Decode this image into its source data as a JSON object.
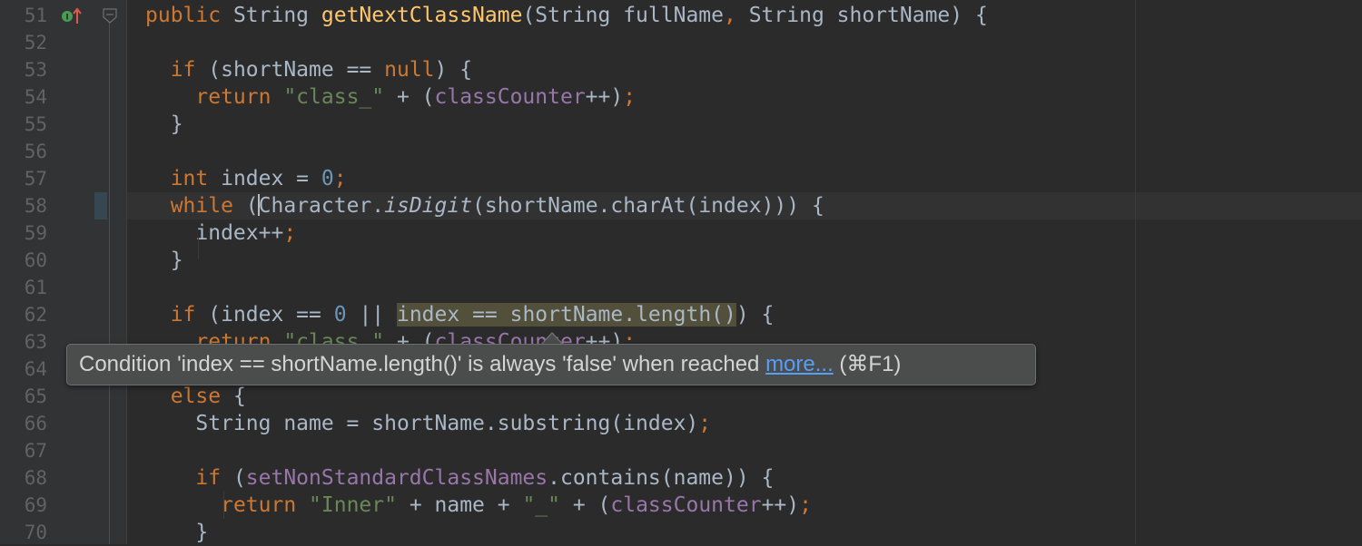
{
  "gutter": {
    "line_numbers": [
      "51",
      "52",
      "53",
      "54",
      "55",
      "56",
      "57",
      "58",
      "59",
      "60",
      "61",
      "62",
      "63",
      "64",
      "65",
      "66",
      "67",
      "68",
      "69",
      "70"
    ],
    "icons": {
      "implements": "implements-method-icon",
      "fold": "fold-marker-icon"
    }
  },
  "editor": {
    "lines": [
      {
        "n": "51",
        "segments": [
          {
            "t": "public ",
            "c": "kw"
          },
          {
            "t": "String ",
            "c": ""
          },
          {
            "t": "getNextClassName",
            "c": "fn"
          },
          {
            "t": "(String fullName",
            "c": ""
          },
          {
            "t": ", ",
            "c": "kw"
          },
          {
            "t": "String shortName) {",
            "c": ""
          }
        ]
      },
      {
        "n": "52",
        "segments": []
      },
      {
        "n": "53",
        "segments": [
          {
            "t": "  "
          },
          {
            "t": "if ",
            "c": "kw"
          },
          {
            "t": "(shortName == ",
            "c": ""
          },
          {
            "t": "null",
            "c": "kw"
          },
          {
            "t": ") {",
            "c": ""
          }
        ]
      },
      {
        "n": "54",
        "segments": [
          {
            "t": "    "
          },
          {
            "t": "return ",
            "c": "kw"
          },
          {
            "t": "\"class_\"",
            "c": "str"
          },
          {
            "t": " + (",
            "c": ""
          },
          {
            "t": "classCounter",
            "c": "fld"
          },
          {
            "t": "++)",
            "c": ""
          },
          {
            "t": ";",
            "c": "kw"
          }
        ]
      },
      {
        "n": "55",
        "segments": [
          {
            "t": "  }",
            "c": ""
          }
        ]
      },
      {
        "n": "56",
        "segments": []
      },
      {
        "n": "57",
        "segments": [
          {
            "t": "  "
          },
          {
            "t": "int ",
            "c": "kw"
          },
          {
            "t": "index = ",
            "c": ""
          },
          {
            "t": "0",
            "c": "num"
          },
          {
            "t": ";",
            "c": "kw"
          }
        ]
      },
      {
        "n": "58",
        "segments": [
          {
            "t": "  "
          },
          {
            "t": "while ",
            "c": "kw"
          },
          {
            "t": "(",
            "c": ""
          },
          {
            "t": "",
            "c": "caret"
          },
          {
            "t": "Character.",
            "c": ""
          },
          {
            "t": "isDigit",
            "c": "it"
          },
          {
            "t": "(shortName.charAt(index))) {",
            "c": ""
          }
        ]
      },
      {
        "n": "59",
        "segments": [
          {
            "t": "    index++",
            "c": ""
          },
          {
            "t": ";",
            "c": "kw"
          }
        ]
      },
      {
        "n": "60",
        "segments": [
          {
            "t": "  }",
            "c": ""
          }
        ]
      },
      {
        "n": "61",
        "segments": []
      },
      {
        "n": "62",
        "segments": [
          {
            "t": "  "
          },
          {
            "t": "if ",
            "c": "kw"
          },
          {
            "t": "(index == ",
            "c": ""
          },
          {
            "t": "0",
            "c": "num"
          },
          {
            "t": " || ",
            "c": ""
          },
          {
            "t": "index == shortName.length()",
            "c": "warn"
          },
          {
            "t": ") {",
            "c": ""
          }
        ]
      },
      {
        "n": "63",
        "segments": [
          {
            "t": "    "
          },
          {
            "t": "return ",
            "c": "kw"
          },
          {
            "t": "\"class_\"",
            "c": "str"
          },
          {
            "t": " + (",
            "c": ""
          },
          {
            "t": "classCounter",
            "c": "fld"
          },
          {
            "t": "++)",
            "c": ""
          },
          {
            "t": ";",
            "c": "kw"
          }
        ]
      },
      {
        "n": "64",
        "segments": [
          {
            "t": "  }",
            "c": ""
          }
        ]
      },
      {
        "n": "65",
        "segments": [
          {
            "t": "  "
          },
          {
            "t": "else ",
            "c": "kw"
          },
          {
            "t": "{",
            "c": ""
          }
        ]
      },
      {
        "n": "66",
        "segments": [
          {
            "t": "    String name = shortName.substring(index)",
            "c": ""
          },
          {
            "t": ";",
            "c": "kw"
          }
        ]
      },
      {
        "n": "67",
        "segments": []
      },
      {
        "n": "68",
        "segments": [
          {
            "t": "    "
          },
          {
            "t": "if ",
            "c": "kw"
          },
          {
            "t": "(",
            "c": ""
          },
          {
            "t": "setNonStandardClassNames",
            "c": "fld"
          },
          {
            "t": ".contains(name)) {",
            "c": ""
          }
        ]
      },
      {
        "n": "69",
        "segments": [
          {
            "t": "      "
          },
          {
            "t": "return ",
            "c": "kw"
          },
          {
            "t": "\"Inner\"",
            "c": "str"
          },
          {
            "t": " + name + ",
            "c": ""
          },
          {
            "t": "\"_\"",
            "c": "str"
          },
          {
            "t": " + (",
            "c": ""
          },
          {
            "t": "classCounter",
            "c": "fld"
          },
          {
            "t": "++)",
            "c": ""
          },
          {
            "t": ";",
            "c": "kw"
          }
        ]
      },
      {
        "n": "70",
        "segments": [
          {
            "t": "    }",
            "c": ""
          }
        ]
      }
    ]
  },
  "tooltip": {
    "message": "Condition 'index == shortName.length()' is always 'false' when reached ",
    "link_label": "more...",
    "shortcut": " (⌘F1)"
  },
  "colors": {
    "background": "#2b2b2b",
    "gutter": "#313335",
    "keyword": "#cc7832",
    "string": "#6a8759",
    "number": "#6897bb",
    "field": "#9876aa",
    "method": "#ffc66d",
    "text": "#a9b7c6",
    "warning_highlight": "#52503a",
    "link": "#589df6"
  }
}
